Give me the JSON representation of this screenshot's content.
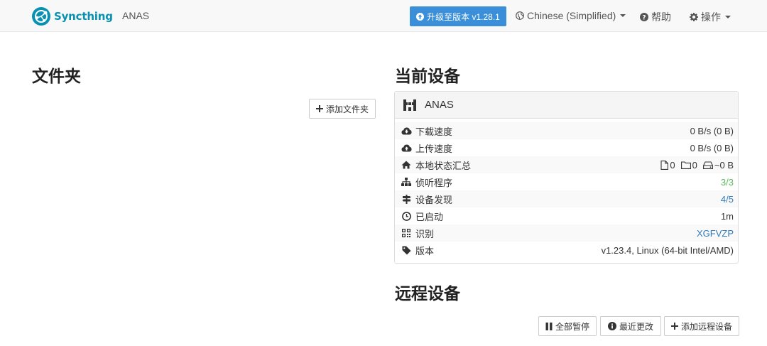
{
  "nav": {
    "brand": "Syncthing",
    "device_name": "ANAS",
    "upgrade_label": "升级至版本 v1.28.1",
    "language_label": "Chinese (Simplified)",
    "help_label": "帮助",
    "actions_label": "操作"
  },
  "folders": {
    "title": "文件夹",
    "add_folder_label": "添加文件夹"
  },
  "this_device": {
    "title": "当前设备",
    "name": "ANAS",
    "rows": [
      {
        "label": "下载速度",
        "value": "0 B/s (0 B)",
        "icon": "cloud-download-icon"
      },
      {
        "label": "上传速度",
        "value": "0 B/s (0 B)",
        "icon": "cloud-upload-icon"
      },
      {
        "label": "本地状态汇总",
        "icon": "home-icon",
        "files": "0",
        "dirs": "0",
        "size": "~0 B"
      },
      {
        "label": "侦听程序",
        "value": "3/3",
        "icon": "sitemap-icon",
        "color": "#5cb85c"
      },
      {
        "label": "设备发现",
        "value": "4/5",
        "icon": "signpost-icon",
        "color": "#337ab7"
      },
      {
        "label": "已启动",
        "value": "1m",
        "icon": "clock-icon"
      },
      {
        "label": "识别",
        "value": "XGFVZP",
        "icon": "qrcode-icon",
        "color": "#337ab7"
      },
      {
        "label": "版本",
        "value": "v1.23.4, Linux (64-bit Intel/AMD)",
        "icon": "tag-icon"
      }
    ]
  },
  "remote_devices": {
    "title": "远程设备",
    "pause_all_label": "全部暂停",
    "recent_changes_label": "最近更改",
    "add_remote_label": "添加远程设备"
  },
  "colors": {
    "brand": "#0891b2",
    "primary": "#3a8fd8",
    "ok": "#5cb85c",
    "link": "#337ab7"
  }
}
